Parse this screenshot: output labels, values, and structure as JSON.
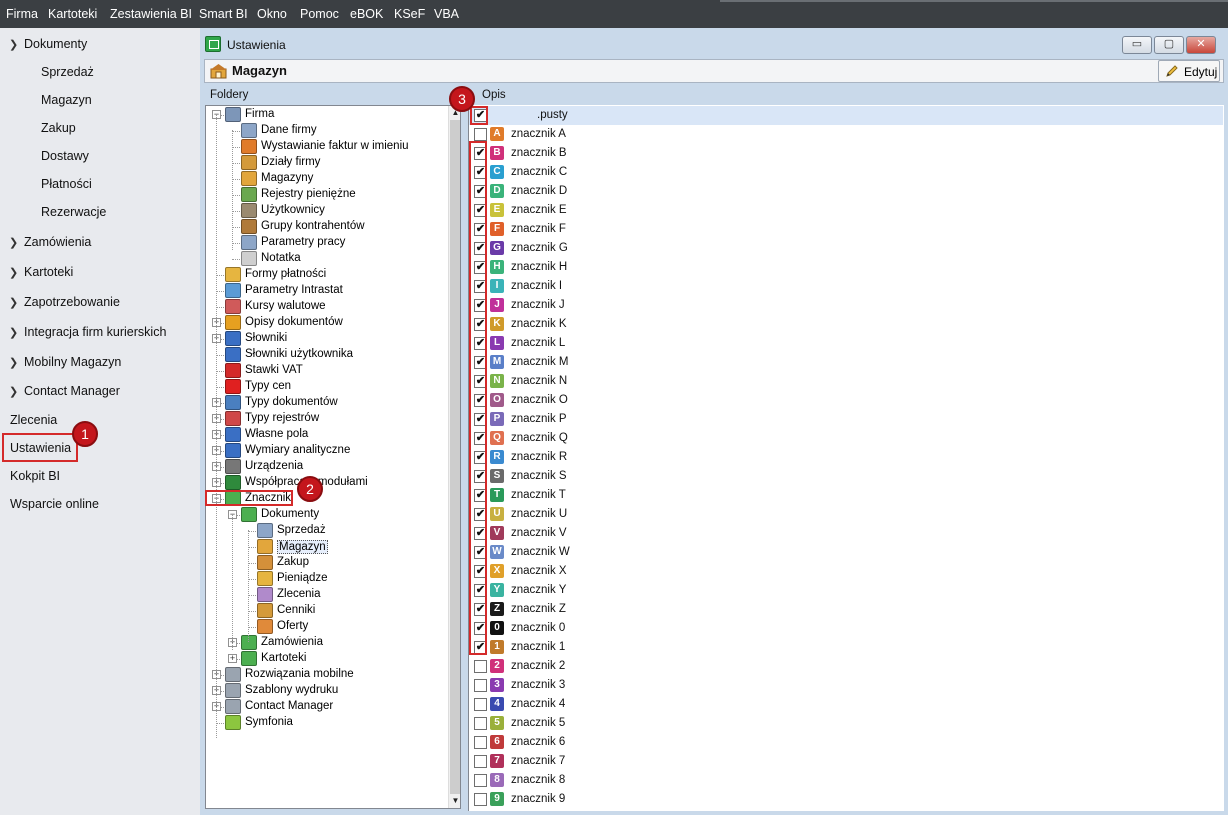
{
  "menubar": [
    "Firma",
    "Kartoteki",
    "Zestawienia BI",
    "Smart BI",
    "Okno",
    "Pomoc",
    "eBOK",
    "KSeF",
    "VBA"
  ],
  "nav": {
    "dokumenty": "Dokumenty",
    "dokumenty_items": [
      "Sprzedaż",
      "Magazyn",
      "Zakup",
      "Dostawy",
      "Płatności",
      "Rezerwacje"
    ],
    "groups": [
      "Zamówienia",
      "Kartoteki",
      "Zapotrzebowanie",
      "Integracja firm kurierskich",
      "Mobilny Magazyn",
      "Contact Manager"
    ],
    "plain": [
      "Zlecenia",
      "Ustawienia",
      "Kokpit BI",
      "Wsparcie online"
    ]
  },
  "badges": [
    "1",
    "2",
    "3"
  ],
  "window": {
    "title": "Ustawienia",
    "header": "Magazyn",
    "edit_label": "Edytuj",
    "folders_label": "Foldery",
    "opis_label": "Opis",
    "win_buttons": [
      "▭",
      "▢",
      "✕"
    ]
  },
  "tree": [
    {
      "label": "Firma",
      "level": 0,
      "toggle": "-",
      "icon": "building-icon",
      "color": "#7d96b8"
    },
    {
      "label": "Dane firmy",
      "level": 1,
      "icon": "company-data-icon",
      "color": "#8da6c8"
    },
    {
      "label": "Wystawianie faktur w imieniu",
      "level": 1,
      "icon": "person-icon",
      "color": "#e07b2a"
    },
    {
      "label": "Działy firmy",
      "level": 1,
      "icon": "departments-icon",
      "color": "#d49a3a"
    },
    {
      "label": "Magazyny",
      "level": 1,
      "icon": "warehouse-icon",
      "color": "#e2a63c"
    },
    {
      "label": "Rejestry pieniężne",
      "level": 1,
      "icon": "money-icon",
      "color": "#6aa84f"
    },
    {
      "label": "Użytkownicy",
      "level": 1,
      "icon": "users-icon",
      "color": "#9a8a70"
    },
    {
      "label": "Grupy kontrahentów",
      "level": 1,
      "icon": "groups-icon",
      "color": "#b07a3a"
    },
    {
      "label": "Parametry pracy",
      "level": 1,
      "icon": "parameters-icon",
      "color": "#8da6c8"
    },
    {
      "label": "Notatka",
      "level": 1,
      "icon": "note-icon",
      "color": "#cfcfcf"
    },
    {
      "label": "Formy płatności",
      "level": 0,
      "icon": "payment-forms-icon",
      "color": "#e6b540"
    },
    {
      "label": "Parametry Intrastat",
      "level": 0,
      "icon": "intrastat-icon",
      "color": "#5b9bd5"
    },
    {
      "label": "Kursy walutowe",
      "level": 0,
      "icon": "currency-rates-icon",
      "color": "#d05a5a"
    },
    {
      "label": "Opisy dokumentów",
      "level": 0,
      "toggle": "+",
      "icon": "doc-descriptions-icon",
      "color": "#e6a020"
    },
    {
      "label": "Słowniki",
      "level": 0,
      "toggle": "+",
      "icon": "dictionary-icon",
      "color": "#3a6fc4"
    },
    {
      "label": "Słowniki użytkownika",
      "level": 0,
      "icon": "user-dictionary-icon",
      "color": "#3a6fc4"
    },
    {
      "label": "Stawki VAT",
      "level": 0,
      "icon": "vat-icon",
      "color": "#d42a2a"
    },
    {
      "label": "Typy cen",
      "level": 0,
      "icon": "price-types-icon",
      "color": "#e02020"
    },
    {
      "label": "Typy dokumentów",
      "level": 0,
      "toggle": "+",
      "icon": "doc-types-icon",
      "color": "#4a7fc0"
    },
    {
      "label": "Typy rejestrów",
      "level": 0,
      "toggle": "+",
      "icon": "register-types-icon",
      "color": "#d04848"
    },
    {
      "label": "Własne pola",
      "level": 0,
      "toggle": "+",
      "icon": "custom-fields-icon",
      "color": "#3a6fc4"
    },
    {
      "label": "Wymiary analityczne",
      "level": 0,
      "toggle": "+",
      "icon": "analytics-icon",
      "color": "#3a6fc4"
    },
    {
      "label": "Urządzenia",
      "level": 0,
      "toggle": "+",
      "icon": "devices-icon",
      "color": "#777777"
    },
    {
      "label": "Współpraca z modułami",
      "level": 0,
      "toggle": "+",
      "icon": "modules-icon",
      "color": "#2f8a3c"
    },
    {
      "label": "Znaczniki",
      "level": 0,
      "toggle": "-",
      "icon": "markers-icon",
      "color": "#4caf50"
    },
    {
      "label": "Dokumenty",
      "level": 1,
      "toggle": "-",
      "icon": "markers-docs-icon",
      "color": "#4caf50"
    },
    {
      "label": "Sprzedaż",
      "level": 2,
      "icon": "sales-icon",
      "color": "#8da6c8"
    },
    {
      "label": "Magazyn",
      "level": 2,
      "icon": "warehouse-icon",
      "color": "#e2a63c",
      "selected": true
    },
    {
      "label": "Zakup",
      "level": 2,
      "icon": "purchase-icon",
      "color": "#d4903a"
    },
    {
      "label": "Pieniądze",
      "level": 2,
      "icon": "cash-icon",
      "color": "#e6b540"
    },
    {
      "label": "Zlecenia",
      "level": 2,
      "icon": "orders-icon",
      "color": "#b08acb"
    },
    {
      "label": "Cenniki",
      "level": 2,
      "icon": "price-list-icon",
      "color": "#d49a3a"
    },
    {
      "label": "Oferty",
      "level": 2,
      "icon": "offers-icon",
      "color": "#e08a3a"
    },
    {
      "label": "Zamówienia",
      "level": 1,
      "toggle": "+",
      "icon": "markers-orders-icon",
      "color": "#4caf50"
    },
    {
      "label": "Kartoteki",
      "level": 1,
      "toggle": "+",
      "icon": "markers-files-icon",
      "color": "#4caf50"
    },
    {
      "label": "Rozwiązania mobilne",
      "level": 0,
      "toggle": "+",
      "icon": "mobile-icon",
      "color": "#9aa4b0"
    },
    {
      "label": "Szablony wydruku",
      "level": 0,
      "toggle": "+",
      "icon": "print-templates-icon",
      "color": "#9aa4b0"
    },
    {
      "label": "Contact Manager",
      "level": 0,
      "toggle": "+",
      "icon": "contact-manager-icon",
      "color": "#9aa4b0"
    },
    {
      "label": "Symfonia",
      "level": 0,
      "icon": "symfonia-icon",
      "color": "#8cc63f"
    }
  ],
  "list": [
    {
      "label": ".pusty",
      "checked": true,
      "tag": "",
      "color": ""
    },
    {
      "label": "znacznik A",
      "checked": false,
      "tag": "A",
      "color": "#e07b2a"
    },
    {
      "label": "znacznik B",
      "checked": true,
      "tag": "B",
      "color": "#d0307a"
    },
    {
      "label": "znacznik C",
      "checked": true,
      "tag": "C",
      "color": "#2a9fd0"
    },
    {
      "label": "znacznik D",
      "checked": true,
      "tag": "D",
      "color": "#3ab37a"
    },
    {
      "label": "znacznik E",
      "checked": true,
      "tag": "E",
      "color": "#c9c23a"
    },
    {
      "label": "znacznik F",
      "checked": true,
      "tag": "F",
      "color": "#e0602a"
    },
    {
      "label": "znacznik G",
      "checked": true,
      "tag": "G",
      "color": "#6a3aa8"
    },
    {
      "label": "znacznik H",
      "checked": true,
      "tag": "H",
      "color": "#3ab37a"
    },
    {
      "label": "znacznik I",
      "checked": true,
      "tag": "I",
      "color": "#3ab3b8"
    },
    {
      "label": "znacznik J",
      "checked": true,
      "tag": "J",
      "color": "#c0309a"
    },
    {
      "label": "znacznik K",
      "checked": true,
      "tag": "K",
      "color": "#d09a2a"
    },
    {
      "label": "znacznik L",
      "checked": true,
      "tag": "L",
      "color": "#8a3ab0"
    },
    {
      "label": "znacznik M",
      "checked": true,
      "tag": "M",
      "color": "#5a7fc8"
    },
    {
      "label": "znacznik N",
      "checked": true,
      "tag": "N",
      "color": "#7ab34a"
    },
    {
      "label": "znacznik O",
      "checked": true,
      "tag": "O",
      "color": "#a05a8a"
    },
    {
      "label": "znacznik P",
      "checked": true,
      "tag": "P",
      "color": "#7a6ab8"
    },
    {
      "label": "znacznik Q",
      "checked": true,
      "tag": "Q",
      "color": "#e07050"
    },
    {
      "label": "znacznik R",
      "checked": true,
      "tag": "R",
      "color": "#3a8ad0"
    },
    {
      "label": "znacznik S",
      "checked": true,
      "tag": "S",
      "color": "#6a6a6a"
    },
    {
      "label": "znacznik T",
      "checked": true,
      "tag": "T",
      "color": "#2a9a5a"
    },
    {
      "label": "znacznik U",
      "checked": true,
      "tag": "U",
      "color": "#c8b040"
    },
    {
      "label": "znacznik V",
      "checked": true,
      "tag": "V",
      "color": "#a03a5a"
    },
    {
      "label": "znacznik W",
      "checked": true,
      "tag": "W",
      "color": "#6a8ac8"
    },
    {
      "label": "znacznik X",
      "checked": true,
      "tag": "X",
      "color": "#e0a02a"
    },
    {
      "label": "znacznik Y",
      "checked": true,
      "tag": "Y",
      "color": "#3ab3a0"
    },
    {
      "label": "znacznik Z",
      "checked": true,
      "tag": "Z",
      "color": "#1a1a1a"
    },
    {
      "label": "znacznik 0",
      "checked": true,
      "tag": "0",
      "color": "#111111"
    },
    {
      "label": "znacznik 1",
      "checked": true,
      "tag": "1",
      "color": "#c07a2a"
    },
    {
      "label": "znacznik 2",
      "checked": false,
      "tag": "2",
      "color": "#d0307a"
    },
    {
      "label": "znacznik 3",
      "checked": false,
      "tag": "3",
      "color": "#8a3ab0"
    },
    {
      "label": "znacznik 4",
      "checked": false,
      "tag": "4",
      "color": "#3a4ab0"
    },
    {
      "label": "znacznik 5",
      "checked": false,
      "tag": "5",
      "color": "#9ab03a"
    },
    {
      "label": "znacznik 6",
      "checked": false,
      "tag": "6",
      "color": "#c03a3a"
    },
    {
      "label": "znacznik 7",
      "checked": false,
      "tag": "7",
      "color": "#b0305a"
    },
    {
      "label": "znacznik 8",
      "checked": false,
      "tag": "8",
      "color": "#9a6ab8"
    },
    {
      "label": "znacznik 9",
      "checked": false,
      "tag": "9",
      "color": "#3aa05a"
    }
  ]
}
